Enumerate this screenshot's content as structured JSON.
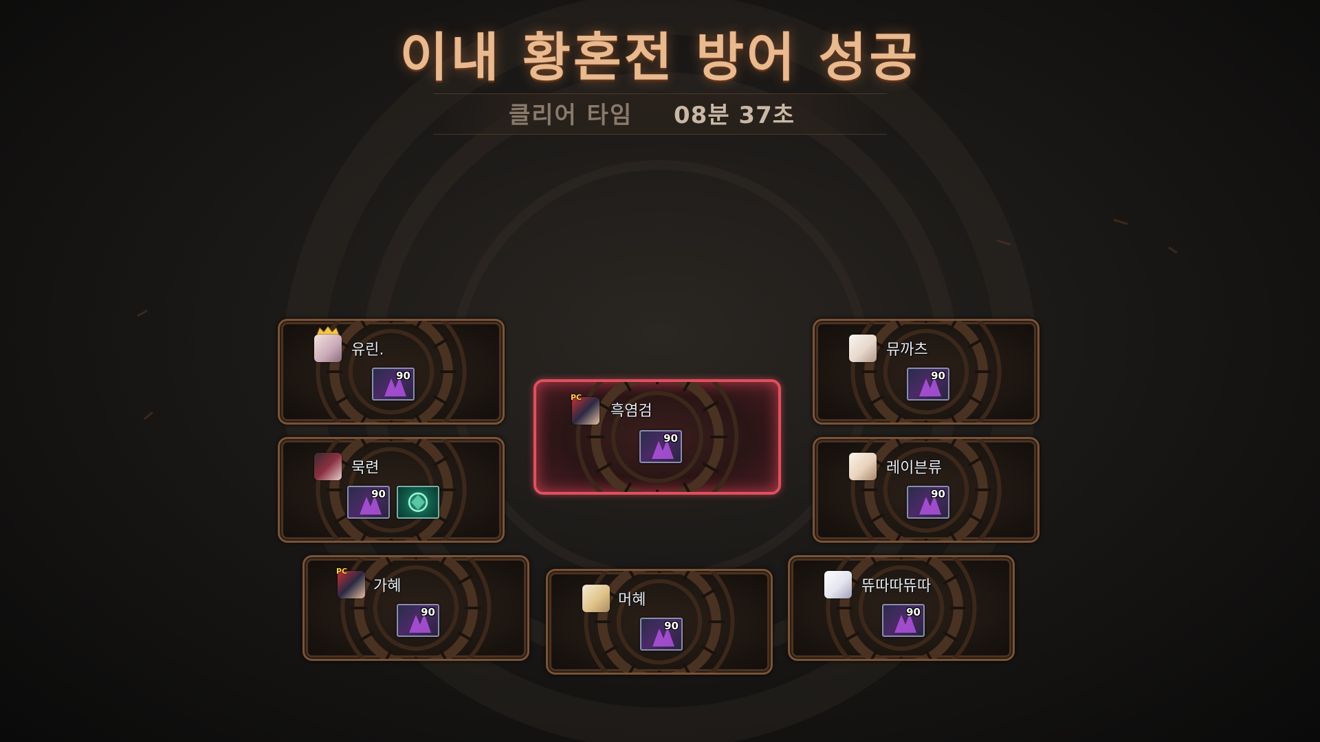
{
  "result": {
    "title": "이내 황혼전 방어 성공",
    "clear_time_label": "클리어 타임",
    "clear_time_value": "08분 37초"
  },
  "party": [
    {
      "id": "yurin",
      "name": "유린.",
      "avatar": "female-character-crown-icon",
      "items": [
        {
          "type": "purple-crystal-icon",
          "level": "90"
        }
      ]
    },
    {
      "id": "mukryeon",
      "name": "묵련",
      "avatar": "dark-haired-character-icon",
      "items": [
        {
          "type": "purple-crystal-icon",
          "level": "90"
        },
        {
          "type": "green-emblem-icon"
        }
      ]
    },
    {
      "id": "gahye",
      "name": "가혜",
      "avatar": "pc-bang-character-icon",
      "pc_tag": "PC",
      "items": [
        {
          "type": "purple-crystal-icon",
          "level": "90"
        }
      ]
    },
    {
      "id": "heukyeomgeom",
      "name": "흑염검",
      "avatar": "pc-bang-character-icon",
      "pc_tag": "PC",
      "highlight": true,
      "items": [
        {
          "type": "purple-crystal-icon",
          "level": "90"
        }
      ]
    },
    {
      "id": "meohye",
      "name": "머혜",
      "avatar": "blonde-character-icon",
      "items": [
        {
          "type": "purple-crystal-icon",
          "level": "90"
        }
      ]
    },
    {
      "id": "myukkacheu",
      "name": "뮤까츠",
      "avatar": "white-haired-character-icon",
      "items": [
        {
          "type": "purple-crystal-icon",
          "level": "90"
        }
      ]
    },
    {
      "id": "raebeunryu",
      "name": "레이븐류",
      "avatar": "white-haired-character-icon",
      "items": [
        {
          "type": "purple-crystal-icon",
          "level": "90"
        }
      ]
    },
    {
      "id": "ttyuttatta",
      "name": "뜌따따뜌따",
      "avatar": "white-haired-character-icon",
      "items": [
        {
          "type": "purple-crystal-icon",
          "level": "90"
        }
      ]
    }
  ],
  "colors": {
    "title": "#e9b98f",
    "highlight_border": "#e24f5e",
    "card_border": "#7a5336",
    "name_text": "#e9eef4"
  }
}
